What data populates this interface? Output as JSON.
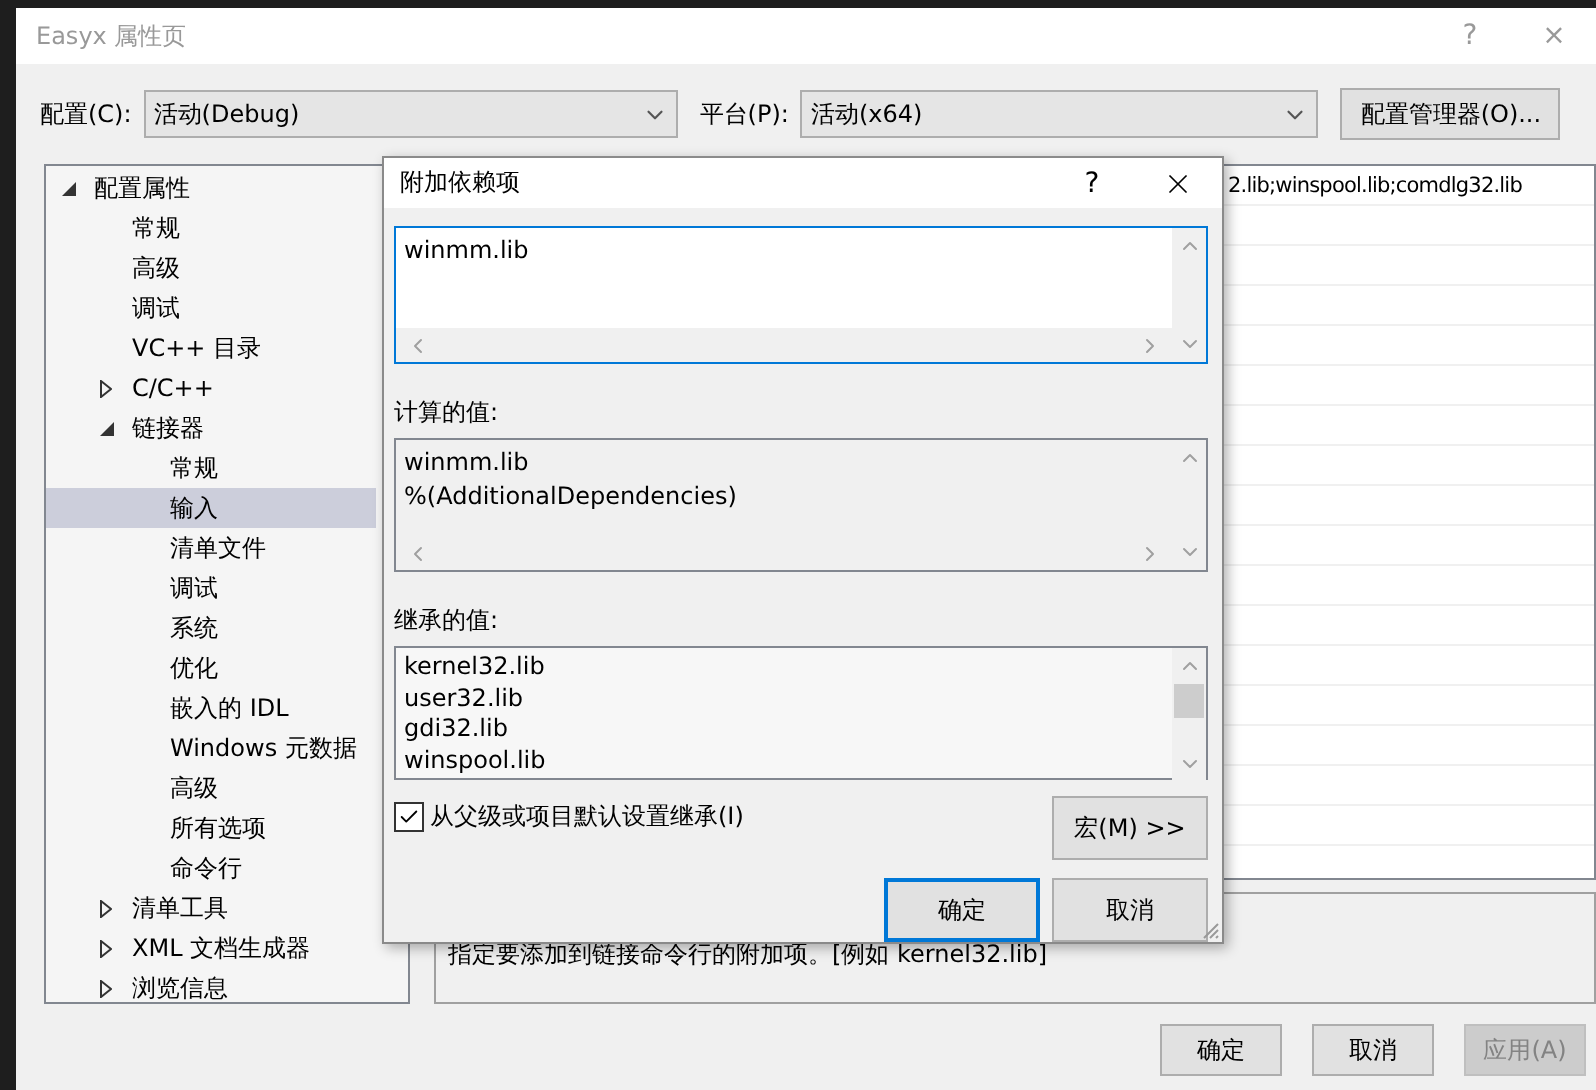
{
  "window": {
    "title": "Easyx 属性页",
    "help": "?",
    "close": "×"
  },
  "config_row": {
    "config_label": "配置(C):",
    "config_value": "活动(Debug)",
    "platform_label": "平台(P):",
    "platform_value": "活动(x64)",
    "manager_button": "配置管理器(O)..."
  },
  "tree": [
    {
      "label": "配置属性",
      "kind": "folder",
      "expanded": true,
      "selected": false,
      "children": [
        {
          "label": "常规",
          "kind": "leaf",
          "selected": false
        },
        {
          "label": "高级",
          "kind": "leaf",
          "selected": false
        },
        {
          "label": "调试",
          "kind": "leaf",
          "selected": false
        },
        {
          "label": "VC++ 目录",
          "kind": "leaf",
          "selected": false
        },
        {
          "label": "C/C++",
          "kind": "folder",
          "expanded": false,
          "selected": false
        },
        {
          "label": "链接器",
          "kind": "folder",
          "expanded": true,
          "selected": false,
          "children": [
            {
              "label": "常规",
              "kind": "leaf",
              "selected": false
            },
            {
              "label": "输入",
              "kind": "leaf",
              "selected": true
            },
            {
              "label": "清单文件",
              "kind": "leaf",
              "selected": false
            },
            {
              "label": "调试",
              "kind": "leaf",
              "selected": false
            },
            {
              "label": "系统",
              "kind": "leaf",
              "selected": false
            },
            {
              "label": "优化",
              "kind": "leaf",
              "selected": false
            },
            {
              "label": "嵌入的 IDL",
              "kind": "leaf",
              "selected": false
            },
            {
              "label": "Windows 元数据",
              "kind": "leaf",
              "selected": false
            },
            {
              "label": "高级",
              "kind": "leaf",
              "selected": false
            },
            {
              "label": "所有选项",
              "kind": "leaf",
              "selected": false
            },
            {
              "label": "命令行",
              "kind": "leaf",
              "selected": false
            }
          ]
        },
        {
          "label": "清单工具",
          "kind": "folder",
          "expanded": false,
          "selected": false
        },
        {
          "label": "XML 文档生成器",
          "kind": "folder",
          "expanded": false,
          "selected": false
        },
        {
          "label": "浏览信息",
          "kind": "folder",
          "expanded": false,
          "selected": false
        }
      ]
    }
  ],
  "grid": {
    "first_row_value": "2.lib;winspool.lib;comdlg32.lib"
  },
  "description": "指定要添加到链接命令行的附加项。[例如 kernel32.lib]",
  "buttons": [
    {
      "label": "确定",
      "disabled": false
    },
    {
      "label": "取消",
      "disabled": false
    },
    {
      "label": "应用(A)",
      "disabled": true
    }
  ],
  "dialog": {
    "title": "附加依赖项",
    "help": "?",
    "value": "winmm.lib",
    "computed_label": "计算的值:",
    "computed_lines": [
      "winmm.lib",
      "%(AdditionalDependencies)"
    ],
    "inherited_label": "继承的值:",
    "inherited_lines": [
      "kernel32.lib",
      "user32.lib",
      "gdi32.lib",
      "winspool.lib"
    ],
    "inherit_checkbox": {
      "label": "从父级或项目默认设置继承(I)",
      "checked": true
    },
    "macro_button": "宏(M) >>",
    "ok": "确定",
    "cancel": "取消"
  }
}
